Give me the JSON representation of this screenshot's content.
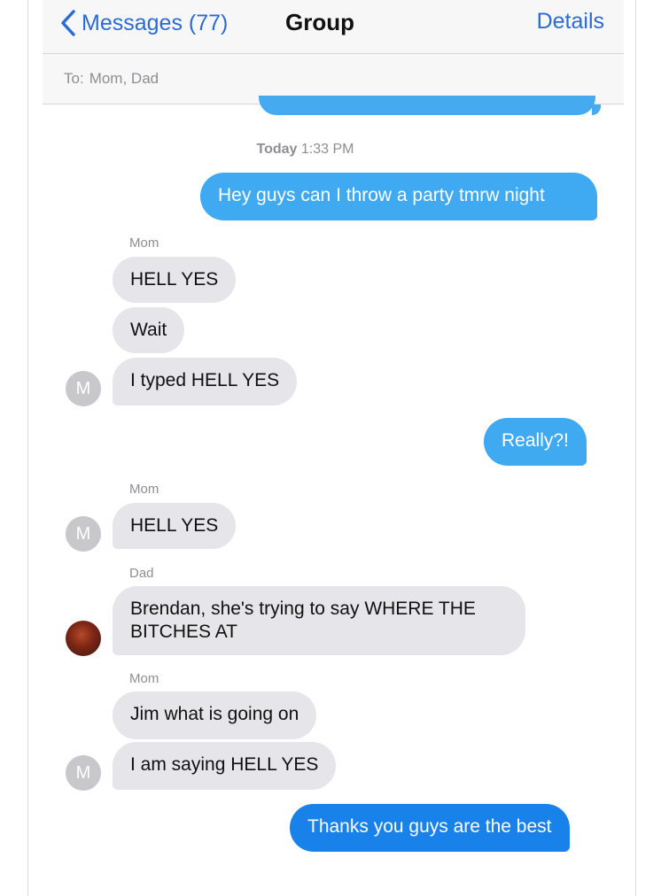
{
  "navbar": {
    "back_label": "Messages (77)",
    "title": "Group",
    "details_label": "Details"
  },
  "recipients": {
    "to_label": "To:",
    "to_value": "Mom, Dad"
  },
  "conversation": {
    "timestamp_day": "Today",
    "timestamp_time": "1:33 PM",
    "messages": [
      {
        "direction": "outgoing",
        "text": "Hey guys can I throw a party tmrw night"
      },
      {
        "direction": "incoming",
        "sender": "Mom",
        "text": "HELL YES"
      },
      {
        "direction": "incoming",
        "text": "Wait"
      },
      {
        "direction": "incoming",
        "text": "I typed HELL YES",
        "avatar_initial": "M"
      },
      {
        "direction": "outgoing",
        "text": "Really?!"
      },
      {
        "direction": "incoming",
        "sender": "Mom",
        "text": "HELL YES",
        "avatar_initial": "M"
      },
      {
        "direction": "incoming",
        "sender": "Dad",
        "text": "Brendan, she's trying to say WHERE THE BITCHES AT",
        "avatar": "photo"
      },
      {
        "direction": "incoming",
        "sender": "Mom",
        "text": "Jim what is going on"
      },
      {
        "direction": "incoming",
        "text": "I am saying HELL YES",
        "avatar_initial": "M"
      },
      {
        "direction": "outgoing",
        "text": "Thanks you guys are the best"
      }
    ]
  },
  "colors": {
    "accent": "#2a6bd6",
    "outgoing_bubble": "#3fa9f2",
    "incoming_bubble": "#e5e5ea"
  },
  "icons": {
    "back": "chevron-left-icon",
    "avatar_photo": "dad-avatar-photo"
  }
}
